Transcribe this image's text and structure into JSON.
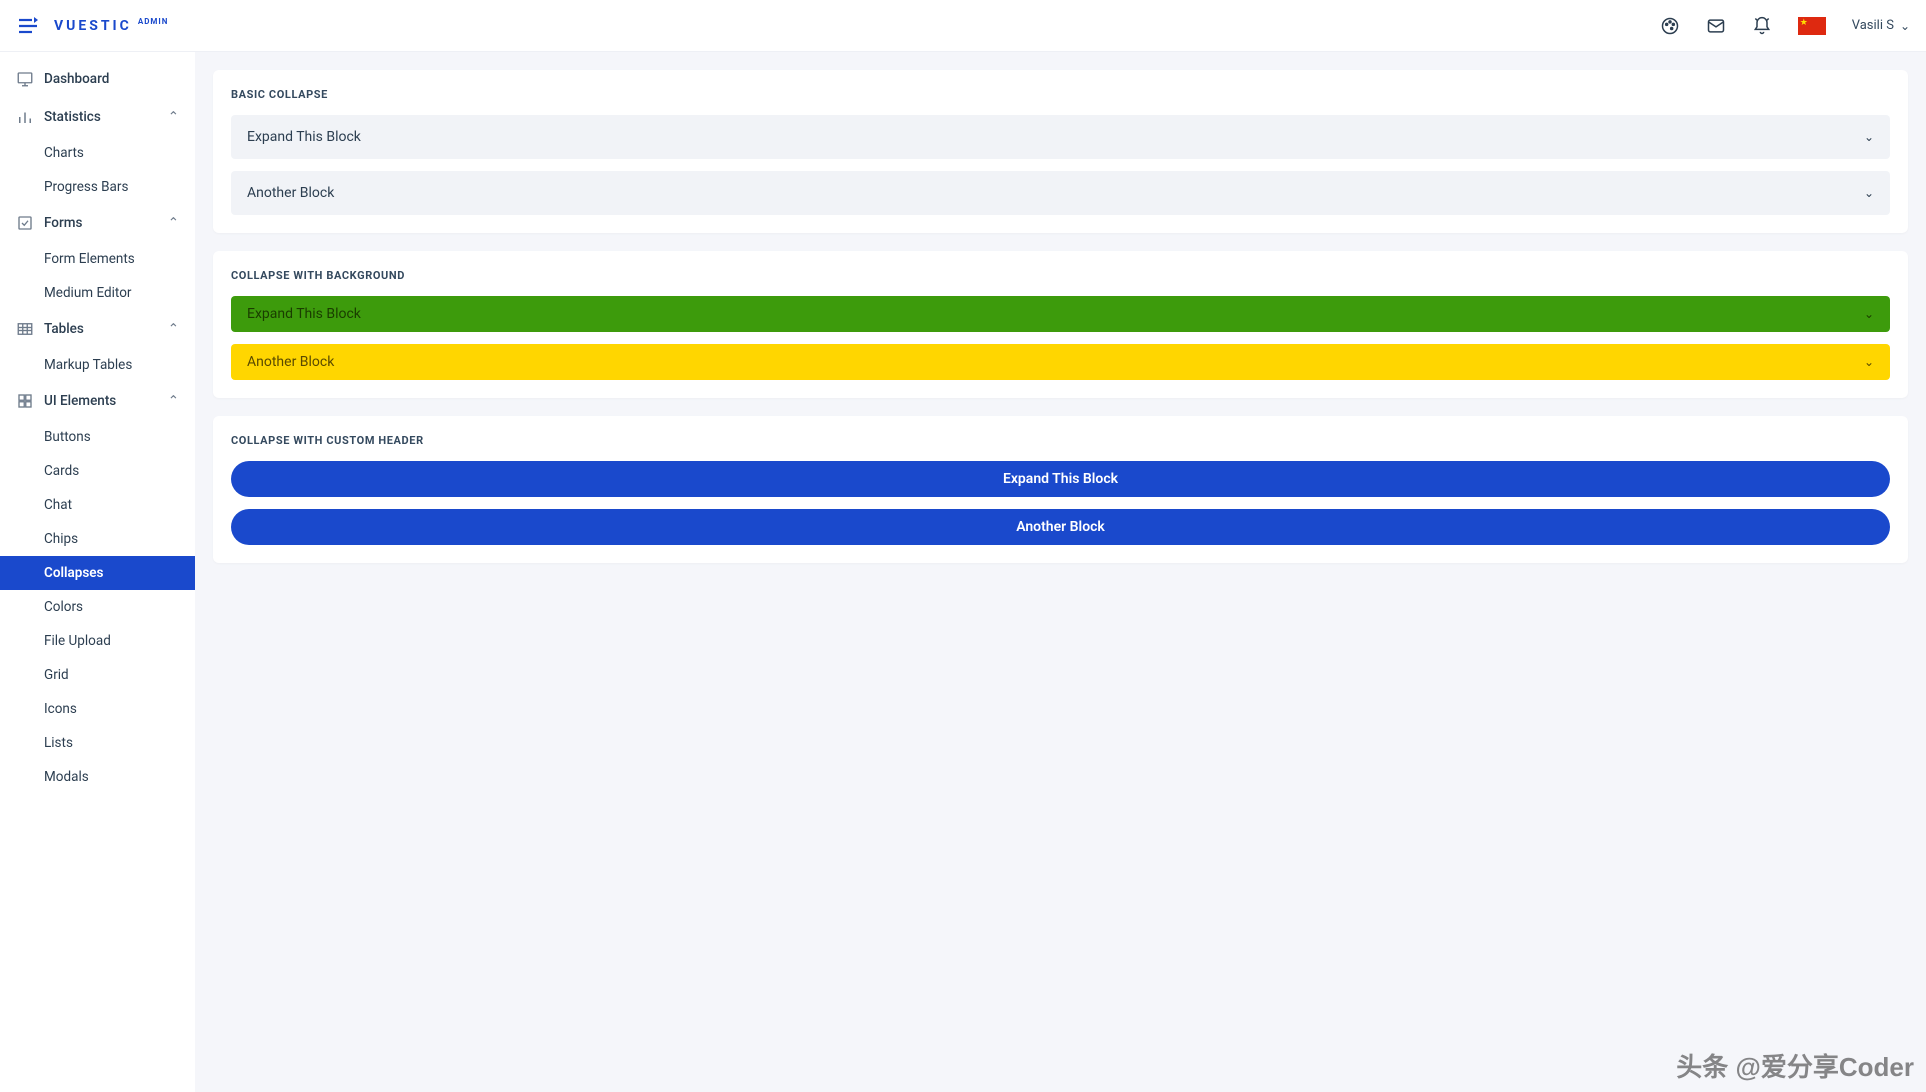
{
  "brand": {
    "name": "VUESTIC",
    "suffix": "ADMIN"
  },
  "user": {
    "name": "Vasili S"
  },
  "sidebar": {
    "dashboard": "Dashboard",
    "statistics": {
      "label": "Statistics",
      "items": [
        "Charts",
        "Progress Bars"
      ]
    },
    "forms": {
      "label": "Forms",
      "items": [
        "Form Elements",
        "Medium Editor"
      ]
    },
    "tables": {
      "label": "Tables",
      "items": [
        "Markup Tables"
      ]
    },
    "uiElements": {
      "label": "UI Elements",
      "items": [
        "Buttons",
        "Cards",
        "Chat",
        "Chips",
        "Collapses",
        "Colors",
        "File Upload",
        "Grid",
        "Icons",
        "Lists",
        "Modals"
      ]
    }
  },
  "cards": {
    "basic": {
      "title": "BASIC COLLAPSE",
      "items": [
        "Expand This Block",
        "Another Block"
      ]
    },
    "bg": {
      "title": "COLLAPSE WITH BACKGROUND",
      "items": [
        "Expand This Block",
        "Another Block"
      ]
    },
    "custom": {
      "title": "COLLAPSE WITH CUSTOM HEADER",
      "items": [
        "Expand This Block",
        "Another Block"
      ]
    }
  },
  "watermark": "头条 @爱分享Coder"
}
